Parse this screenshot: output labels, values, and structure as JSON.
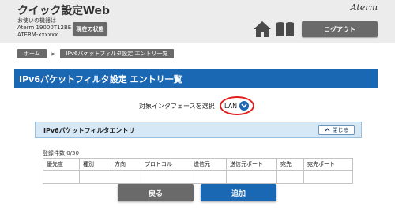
{
  "header": {
    "app_title": "クイック設定Web",
    "device_label": "お使いの機器は",
    "device_model": "Aterm 19000T12BE",
    "device_id": "ATERM-xxxxxx",
    "status_button": "現在の状態",
    "brand": "Aterm",
    "logout_button": "ログアウト",
    "home_icon": "home-icon",
    "manual_icon": "book-icon"
  },
  "breadcrumb": {
    "home": "ホーム",
    "separator": ">",
    "current": "IPv6パケットフィルタ設定 エントリ一覧"
  },
  "page": {
    "title": "IPv6パケットフィルタ設定 エントリ一覧"
  },
  "interface": {
    "label": "対象インタフェースを選択",
    "selected": "LAN",
    "highlight_color": "#e31d1d"
  },
  "panel": {
    "title": "IPv6パケットフィルタエントリ",
    "collapse_label": "閉じる",
    "count_text": "登録件数 0/50",
    "columns": [
      "優先度",
      "種別",
      "方向",
      "プロトコル",
      "送信元",
      "送信元ポート",
      "宛先",
      "宛先ポート"
    ],
    "rows": []
  },
  "actions": {
    "back": "戻る",
    "add": "追加"
  },
  "colors": {
    "accent": "#1a67b4",
    "button_gray": "#6a6a6a",
    "header_bg": "#ececec",
    "panel_bg": "#d6e7f5"
  }
}
